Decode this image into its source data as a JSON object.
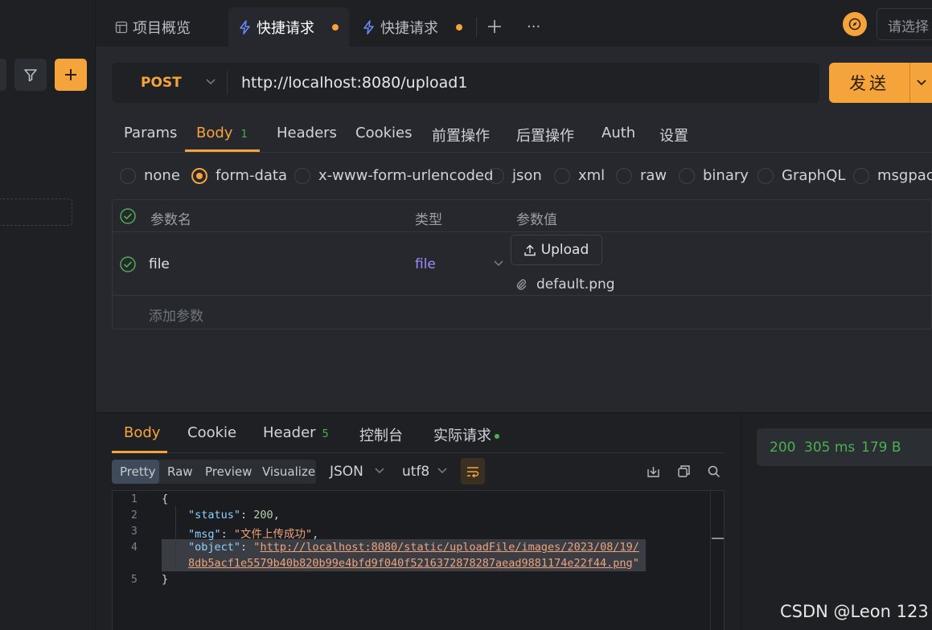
{
  "tabs": [
    {
      "label": "项目概览",
      "icon": "layout-icon"
    },
    {
      "label": "快捷请求",
      "icon": "lightning-icon",
      "active": true,
      "unsaved": true
    },
    {
      "label": "快捷请求",
      "icon": "lightning-icon",
      "unsaved": true
    }
  ],
  "tab_actions": {
    "add": "+",
    "more": "···"
  },
  "env_select_placeholder": "请选择",
  "request": {
    "method": "POST",
    "url": "http://localhost:8080/upload1",
    "send_label": "发送"
  },
  "request_tabs": [
    {
      "label": "Params"
    },
    {
      "label": "Body",
      "badge": "1",
      "active": true
    },
    {
      "label": "Headers"
    },
    {
      "label": "Cookies"
    },
    {
      "label": "前置操作"
    },
    {
      "label": "后置操作"
    },
    {
      "label": "Auth"
    },
    {
      "label": "设置"
    }
  ],
  "body_types": [
    "none",
    "form-data",
    "x-www-form-urlencoded",
    "json",
    "xml",
    "raw",
    "binary",
    "GraphQL",
    "msgpack"
  ],
  "body_type_selected": "form-data",
  "params_table": {
    "headers": {
      "name": "参数名",
      "type": "类型",
      "value": "参数值"
    },
    "rows": [
      {
        "name": "file",
        "type": "file",
        "upload_label": "Upload",
        "file_name": "default.png"
      }
    ],
    "add_placeholder": "添加参数"
  },
  "response": {
    "tabs": [
      {
        "label": "Body",
        "active": true
      },
      {
        "label": "Cookie"
      },
      {
        "label": "Header",
        "badge": "5"
      },
      {
        "label": "控制台"
      },
      {
        "label": "实际请求",
        "dot": true
      }
    ],
    "formats": [
      "Pretty",
      "Raw",
      "Preview",
      "Visualize"
    ],
    "format_selected": "Pretty",
    "lang": "JSON",
    "encoding": "utf8",
    "code": {
      "line_numbers": [
        "1",
        "2",
        "3",
        "4",
        "5"
      ],
      "open_brace": "{",
      "close_brace": "}",
      "status_key": "\"status\"",
      "status_value": "200",
      "msg_key": "\"msg\"",
      "msg_value": "\"文件上传成功\"",
      "object_key": "\"object\"",
      "object_value_part1": "http://localhost:8080/static/uploadFile/images/2023/08/19/",
      "object_value_part2": "8db5acf1e5579b40b820b99e4bfd9f040f5216372878287aead9881174e22f44.png"
    },
    "status": {
      "code": "200",
      "time": "305 ms",
      "size": "179 B"
    }
  },
  "watermark": "CSDN @Leon 123"
}
